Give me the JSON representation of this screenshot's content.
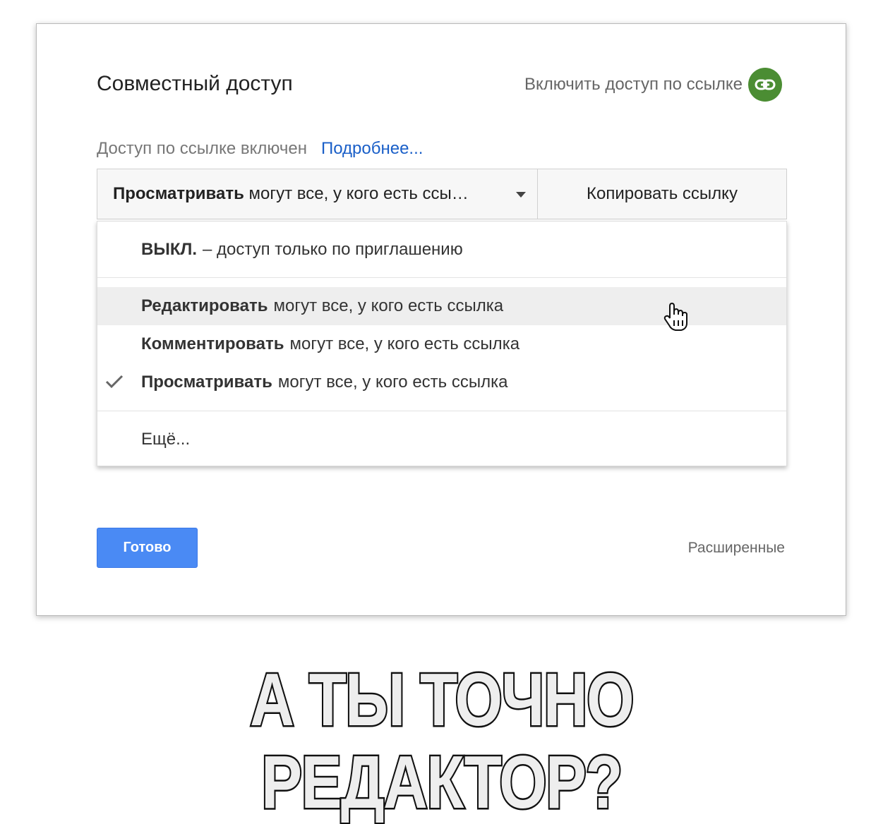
{
  "dialog": {
    "title": "Совместный доступ",
    "link_toggle_label": "Включить доступ по ссылке",
    "link_icon": "link-icon",
    "status_text": "Доступ по ссылке включен",
    "more_link": "Подробнее...",
    "access_select": {
      "bold": "Просматривать",
      "rest": " могут все, у кого есть ссы…"
    },
    "copy_button": "Копировать ссылку",
    "menu": {
      "items": [
        {
          "bold": "ВЫКЛ.",
          "rest": "– доступ только по приглашению"
        },
        {
          "bold": "Редактировать",
          "rest": "могут все, у кого есть ссылка"
        },
        {
          "bold": "Комментировать",
          "rest": "могут все, у кого есть ссылка"
        },
        {
          "bold": "Просматривать",
          "rest": "могут все, у кого есть ссылка"
        },
        {
          "bold": "",
          "rest": "Ещё..."
        }
      ],
      "selected_index": 3,
      "hover_index": 1
    },
    "done_button": "Готово",
    "advanced_link": "Расширенные"
  },
  "caption": "А ТЫ ТОЧНО РЕДАКТОР?",
  "colors": {
    "accent_blue": "#4a8af4",
    "link_green": "#4b8d33",
    "link_text_blue": "#1a5fc8"
  }
}
